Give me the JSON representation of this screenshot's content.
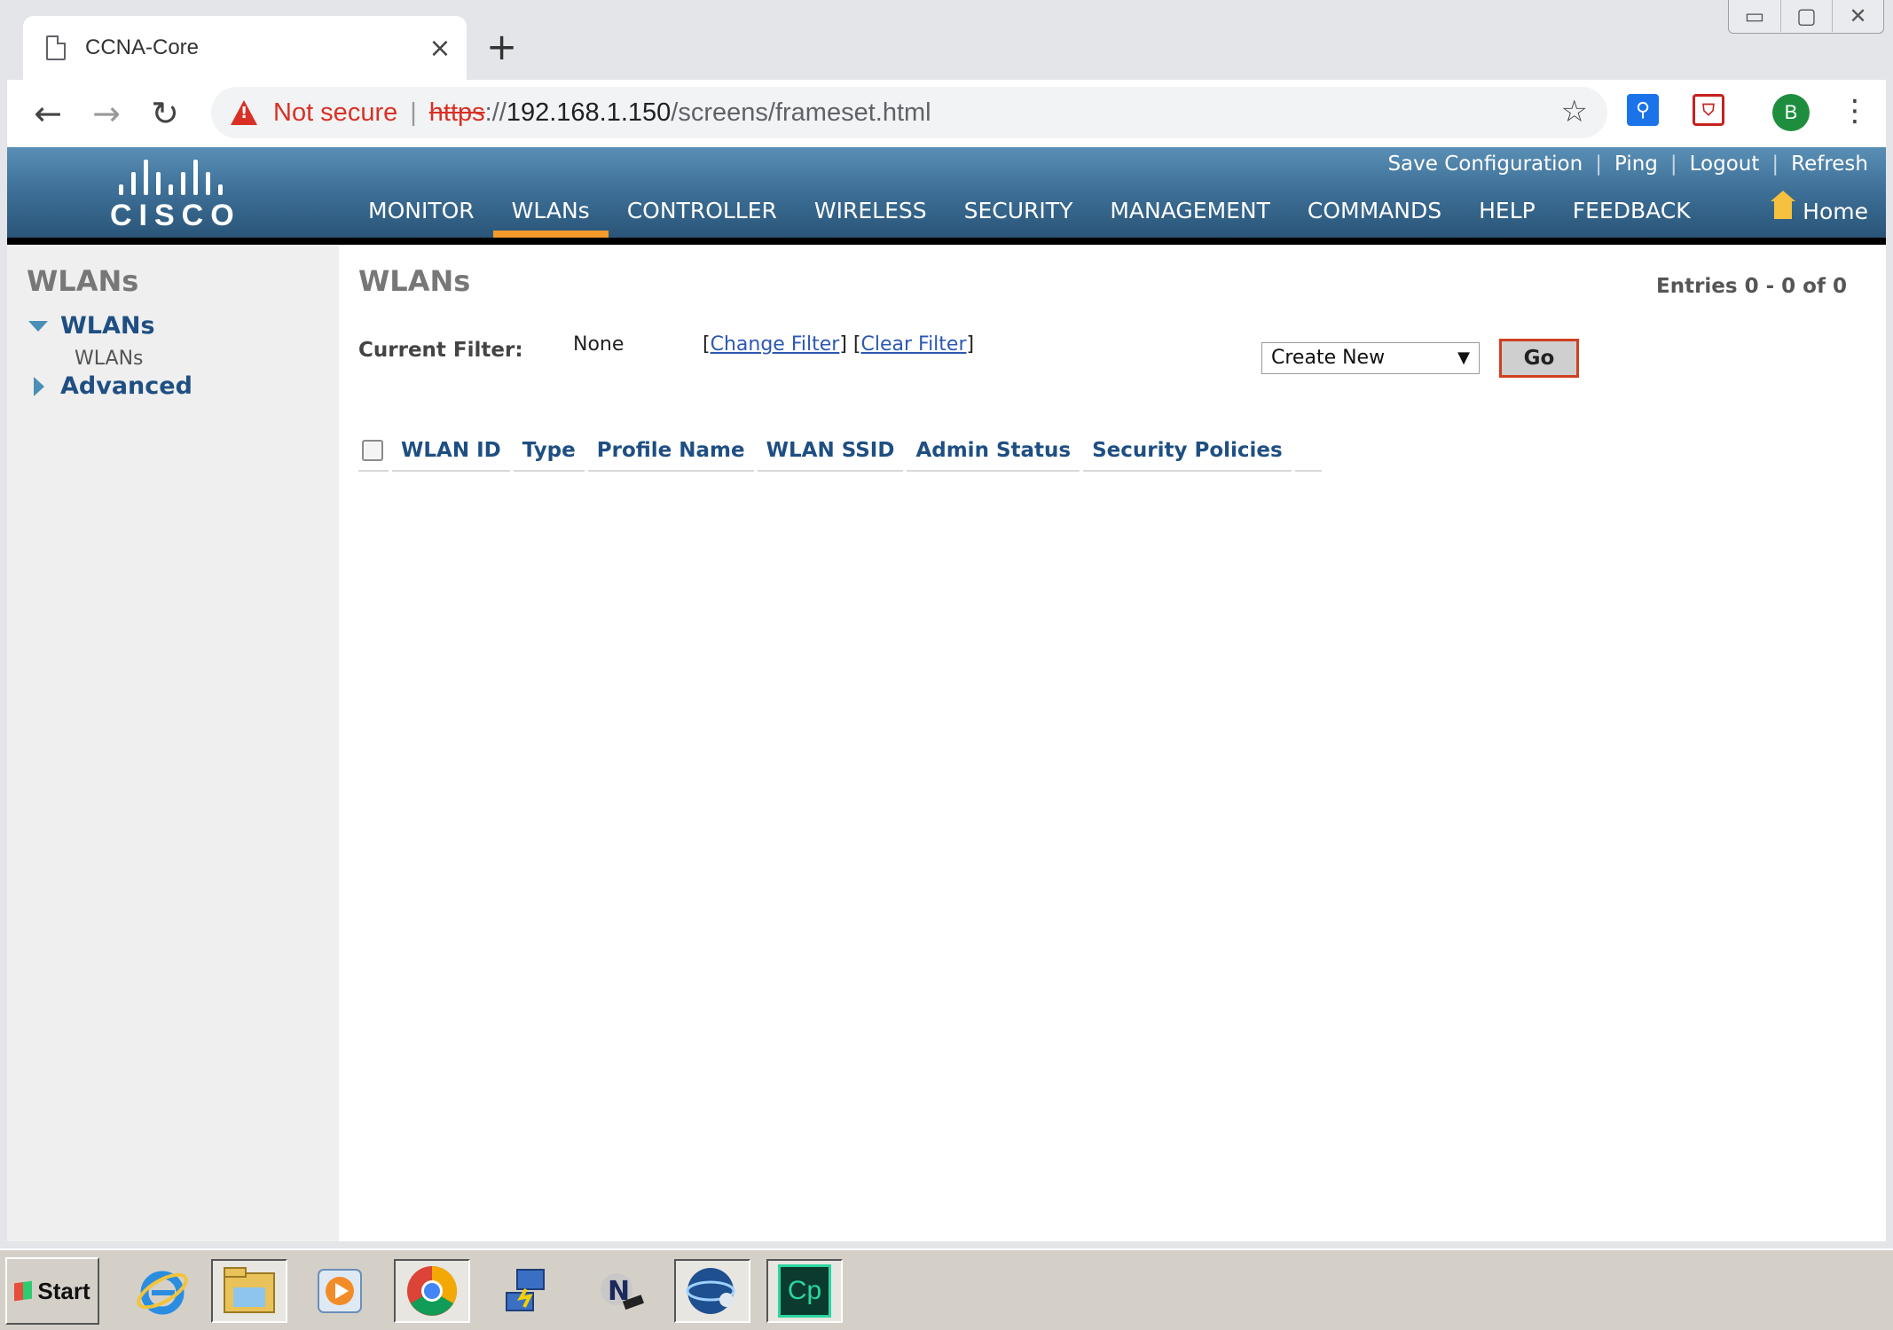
{
  "browser": {
    "tab_title": "CCNA-Core",
    "tab_close": "×",
    "new_tab": "+",
    "security_label": "Not secure",
    "url_scheme": "https",
    "url_separator": "://",
    "url_host": "192.168.1.150",
    "url_path": "/screens/frameset.html",
    "profile_initial": "B",
    "window_controls": [
      "▭",
      "▢",
      "✕"
    ]
  },
  "header": {
    "logo_text": "CISCO",
    "util_links": [
      "Save Configuration",
      "Ping",
      "Logout",
      "Refresh"
    ],
    "nav": [
      "MONITOR",
      "WLANs",
      "CONTROLLER",
      "WIRELESS",
      "SECURITY",
      "MANAGEMENT",
      "COMMANDS",
      "HELP",
      "FEEDBACK"
    ],
    "active_nav": "WLANs",
    "home_label": "Home",
    "accent_color": "#f39a2b"
  },
  "sidebar": {
    "title": "WLANs",
    "groups": [
      {
        "label": "WLANs",
        "expanded": true,
        "children": [
          "WLANs"
        ]
      },
      {
        "label": "Advanced",
        "expanded": false
      }
    ]
  },
  "content": {
    "title": "WLANs",
    "entries": "Entries 0 - 0 of 0",
    "filter_label": "Current Filter:",
    "filter_value": "None",
    "change_filter": "Change Filter",
    "clear_filter": "Clear Filter",
    "action_select": "Create New",
    "go_label": "Go",
    "columns": [
      "WLAN ID",
      "Type",
      "Profile Name",
      "WLAN SSID",
      "Admin Status",
      "Security Policies"
    ]
  },
  "taskbar": {
    "start_label": "Start",
    "apps": [
      "internet-explorer",
      "file-explorer",
      "media-player",
      "chrome",
      "network-tool",
      "netacad-tool",
      "packet-tracer",
      "captivate"
    ],
    "captivate_label": "Cp"
  }
}
